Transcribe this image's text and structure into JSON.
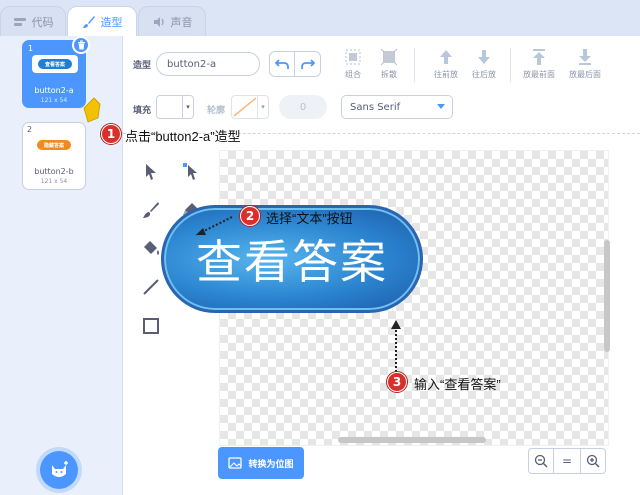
{
  "tabs": [
    {
      "label": "代码",
      "icon": "code-icon"
    },
    {
      "label": "造型",
      "icon": "brush-icon"
    },
    {
      "label": "声音",
      "icon": "speaker-icon"
    }
  ],
  "costumes": [
    {
      "number": "1",
      "name": "button2-a",
      "size": "121 x 54",
      "thumb_text": "查看答案",
      "thumb_color": "#1f7fd1"
    },
    {
      "number": "2",
      "name": "button2-b",
      "size": "121 x 54",
      "thumb_text": "隐藏答案",
      "thumb_color": "#f28a1e"
    }
  ],
  "toolbar": {
    "costume_label": "造型",
    "costume_name": "button2-a",
    "group_label": "组合",
    "ungroup_label": "拆散",
    "forward_label": "往前放",
    "backward_label": "往后放",
    "front_label": "放最前面",
    "back_label": "放最后面",
    "fill_label": "填充",
    "outline_label": "轮廓",
    "outline_width": "0",
    "font": "Sans Serif"
  },
  "canvas": {
    "button_text": "查看答案"
  },
  "bottom": {
    "convert_label": "转换为位图",
    "zoom_out": "−",
    "zoom_reset": "=",
    "zoom_in": "+"
  },
  "annotations": [
    {
      "number": "1",
      "text": "点击“button2-a”造型"
    },
    {
      "number": "2",
      "text": "选择“文本”按钮"
    },
    {
      "number": "3",
      "text": "输入“查看答案”"
    }
  ],
  "colors": {
    "accent": "#4c97ff",
    "annotation": "#d9302c"
  }
}
